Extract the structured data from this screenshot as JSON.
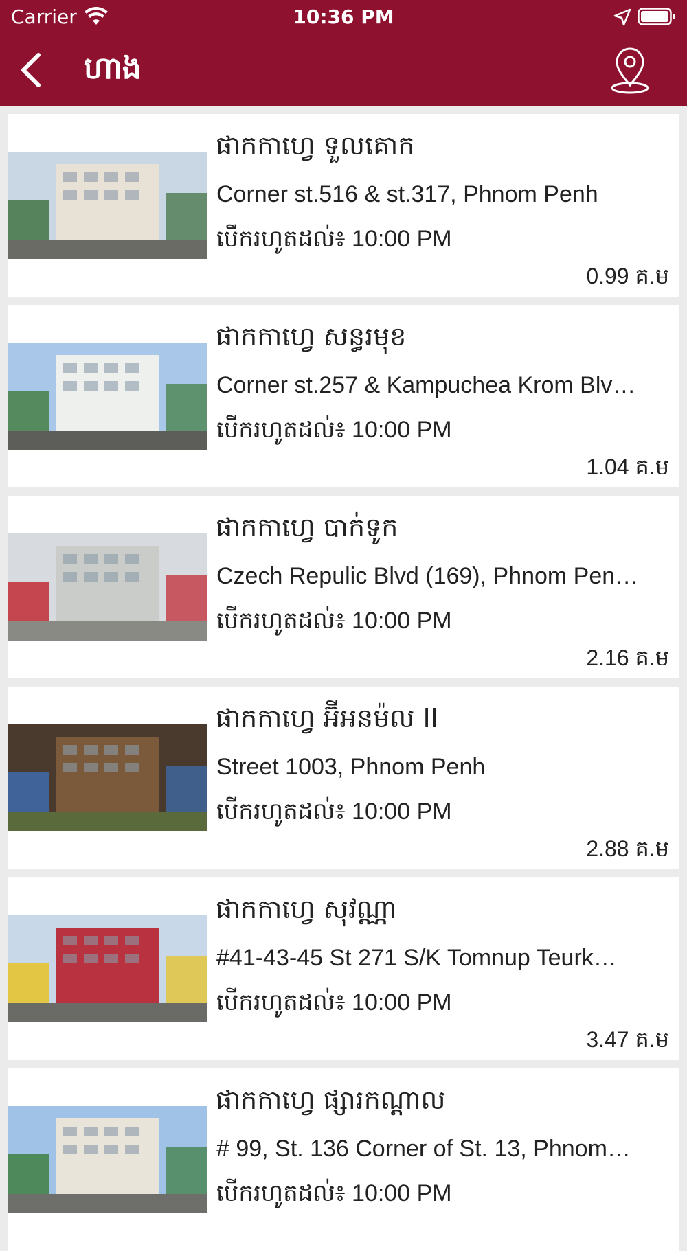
{
  "status_bar": {
    "carrier": "Carrier",
    "time": "10:36 PM"
  },
  "nav": {
    "title": "ហាង"
  },
  "stores": [
    {
      "name": "ផាកកាហ្វេ ទួលគោក",
      "address": "Corner st.516 & st.317, Phnom Penh",
      "hours": "បើករហូតដល់៖ 10:00 PM",
      "distance": "0.99 គ.ម",
      "thumb_colors": {
        "sky": "#c9d6e3",
        "building": "#e8e2d6",
        "ground": "#6b6b66",
        "accent": "#3a6e3a"
      }
    },
    {
      "name": "ផាកកាហ្វេ សន្ធរមុខ",
      "address": "Corner st.257 & Kampuchea Krom Blv…",
      "hours": "បើករហូតដល់៖ 10:00 PM",
      "distance": "1.04 គ.ម",
      "thumb_colors": {
        "sky": "#a9c7e8",
        "building": "#eef0ee",
        "ground": "#5d5d5a",
        "accent": "#3f7a3a"
      }
    },
    {
      "name": "ផាកកាហ្វេ បាក់ទូក",
      "address": "Czech Repulic Blvd (169), Phnom Pen…",
      "hours": "បើករហូតដល់៖ 10:00 PM",
      "distance": "2.16 គ.ម",
      "thumb_colors": {
        "sky": "#d7dbe0",
        "building": "#c9ccc9",
        "ground": "#8a8a84",
        "accent": "#c0202a"
      }
    },
    {
      "name": "ផាកកាហ្វេ អ៊ីអនម៉ល II",
      "address": "Street 1003, Phnom Penh",
      "hours": "បើករហូតដល់៖ 10:00 PM",
      "distance": "2.88 គ.ម",
      "thumb_colors": {
        "sky": "#4a3a2e",
        "building": "#7a5a3a",
        "ground": "#5a6a3a",
        "accent": "#3d6fb4"
      }
    },
    {
      "name": "ផាកកាហ្វេ សុវណ្ណា",
      "address": "#41-43-45 St 271 S/K Tomnup Teurk…",
      "hours": "បើករហូតដល់៖ 10:00 PM",
      "distance": "3.47 គ.ម",
      "thumb_colors": {
        "sky": "#c8d8e8",
        "building": "#b8323f",
        "ground": "#6a6a66",
        "accent": "#e8c21a"
      }
    },
    {
      "name": "ផាកកាហ្វេ ផ្សារកណ្ដាល",
      "address": "# 99, St. 136 Corner of St. 13, Phnom…",
      "hours": "បើករហូតដល់៖ 10:00 PM",
      "distance": "",
      "thumb_colors": {
        "sky": "#9fc2e6",
        "building": "#e9e4da",
        "ground": "#6e6e6a",
        "accent": "#3a7a3a"
      }
    }
  ]
}
